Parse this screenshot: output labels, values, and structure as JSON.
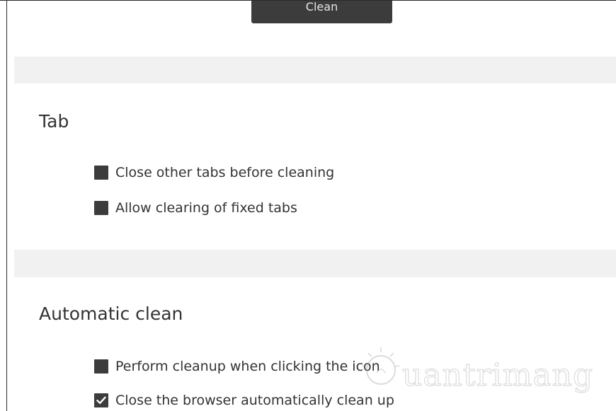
{
  "toolbar": {
    "clean_label": "Clean"
  },
  "tab_section": {
    "title": "Tab",
    "options": [
      {
        "label": "Close other tabs before cleaning",
        "checked": false
      },
      {
        "label": "Allow clearing of fixed tabs",
        "checked": false
      }
    ]
  },
  "auto_section": {
    "title": "Automatic clean",
    "options": [
      {
        "label": "Perform cleanup when clicking the icon",
        "checked": false
      },
      {
        "label": "Close the browser automatically clean up",
        "checked": true
      }
    ]
  },
  "watermark": {
    "text": "uantrimang",
    "icon": "lightbulb-icon"
  },
  "colors": {
    "checkbox": "#3c3c3c",
    "band": "#f1f1f1",
    "button": "#3c3c3c",
    "text": "#333333"
  }
}
